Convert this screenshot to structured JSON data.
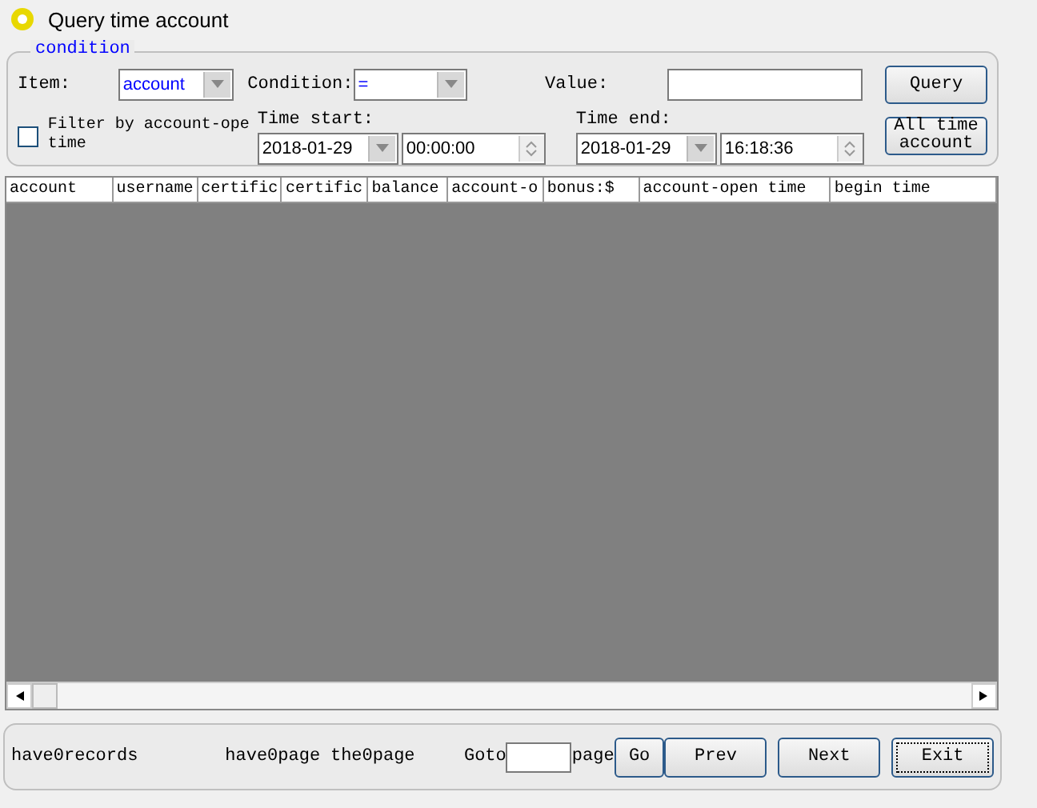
{
  "window": {
    "title": "Query time account"
  },
  "condition": {
    "legend": "condition",
    "item_label": "Item:",
    "item_value": "account",
    "condition_label": "Condition:",
    "condition_value": "=",
    "value_label": "Value:",
    "query_button": "Query",
    "filter": {
      "label": "Filter by account-ope time",
      "checked": false
    },
    "time_start_label": "Time start:",
    "start_date": "2018-01-29",
    "start_time": "00:00:00",
    "time_end_label": "Time end:",
    "end_date": "2018-01-29",
    "end_time": "16:18:36",
    "all_button": "All time account"
  },
  "table": {
    "columns": [
      {
        "label": "account"
      },
      {
        "label": "username"
      },
      {
        "label": "certific"
      },
      {
        "label": "certific"
      },
      {
        "label": "balance"
      },
      {
        "label": "account-o"
      },
      {
        "label": "bonus:$"
      },
      {
        "label": "account-open time"
      },
      {
        "label": "begin time"
      }
    ]
  },
  "footer": {
    "records": "have0records",
    "pages": "have0page",
    "current": "the0page",
    "goto_label": "Goto",
    "page_label": "page",
    "buttons": [
      "Go",
      "Prev",
      "Next",
      "Exit"
    ]
  }
}
